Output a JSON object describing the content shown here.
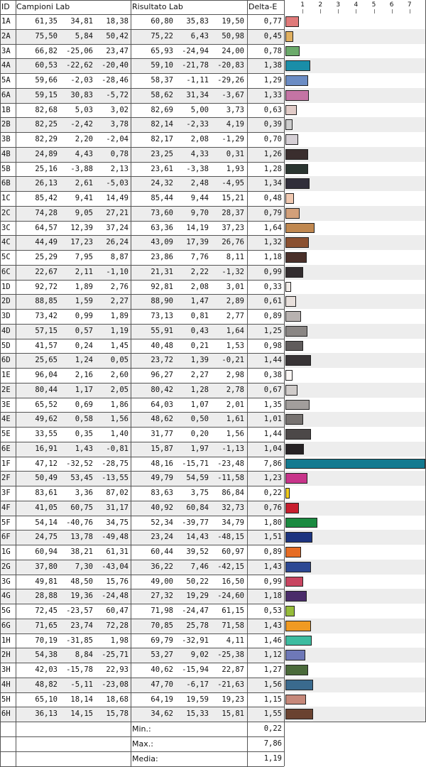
{
  "headers": {
    "id": "ID",
    "campioni": "Campioni Lab",
    "risultato": "Risultato Lab",
    "delta": "Delta-E"
  },
  "scale_ticks": [
    "1",
    "2",
    "3",
    "4",
    "5",
    "6",
    "7"
  ],
  "footer": [
    {
      "label": "Min.:",
      "value": "0,22"
    },
    {
      "label": "Max.:",
      "value": "7,86"
    },
    {
      "label": "Media:",
      "value": "1,19"
    }
  ],
  "chart_data": {
    "type": "bar",
    "xlim": [
      0,
      7.86
    ],
    "rows": [
      {
        "id": "1A",
        "s": [
          "61,35",
          "34,81",
          "18,38"
        ],
        "r": [
          "60,80",
          "35,83",
          "19,50"
        ],
        "de": "0,77",
        "v": 0.77,
        "c": "#e07a7a"
      },
      {
        "id": "2A",
        "s": [
          "75,50",
          "5,84",
          "50,42"
        ],
        "r": [
          "75,22",
          "6,43",
          "50,98"
        ],
        "de": "0,45",
        "v": 0.45,
        "c": "#e0b060"
      },
      {
        "id": "3A",
        "s": [
          "66,82",
          "-25,06",
          "23,47"
        ],
        "r": [
          "65,93",
          "-24,94",
          "24,00"
        ],
        "de": "0,78",
        "v": 0.78,
        "c": "#6aaa6a"
      },
      {
        "id": "4A",
        "s": [
          "60,53",
          "-22,62",
          "-20,40"
        ],
        "r": [
          "59,10",
          "-21,78",
          "-20,83"
        ],
        "de": "1,38",
        "v": 1.38,
        "c": "#1a8ea8"
      },
      {
        "id": "5A",
        "s": [
          "59,66",
          "-2,03",
          "-28,46"
        ],
        "r": [
          "58,37",
          "-1,11",
          "-29,26"
        ],
        "de": "1,29",
        "v": 1.29,
        "c": "#6b8cc4"
      },
      {
        "id": "6A",
        "s": [
          "59,15",
          "30,83",
          "-5,72"
        ],
        "r": [
          "58,62",
          "31,34",
          "-3,67"
        ],
        "de": "1,33",
        "v": 1.33,
        "c": "#c474a4"
      },
      {
        "id": "1B",
        "s": [
          "82,68",
          "5,03",
          "3,02"
        ],
        "r": [
          "82,69",
          "5,00",
          "3,73"
        ],
        "de": "0,63",
        "v": 0.63,
        "c": "#e2ccc8"
      },
      {
        "id": "2B",
        "s": [
          "82,25",
          "-2,42",
          "3,78"
        ],
        "r": [
          "82,14",
          "-2,33",
          "4,19"
        ],
        "de": "0,39",
        "v": 0.39,
        "c": "#cccccc"
      },
      {
        "id": "3B",
        "s": [
          "82,29",
          "2,20",
          "-2,04"
        ],
        "r": [
          "82,17",
          "2,08",
          "-1,29"
        ],
        "de": "0,70",
        "v": 0.7,
        "c": "#d6d0d6"
      },
      {
        "id": "4B",
        "s": [
          "24,89",
          "4,43",
          "0,78"
        ],
        "r": [
          "23,25",
          "4,33",
          "0,31"
        ],
        "de": "1,26",
        "v": 1.26,
        "c": "#3a2e2e"
      },
      {
        "id": "5B",
        "s": [
          "25,16",
          "-3,88",
          "2,13"
        ],
        "r": [
          "23,61",
          "-3,38",
          "1,93"
        ],
        "de": "1,28",
        "v": 1.28,
        "c": "#2a3530"
      },
      {
        "id": "6B",
        "s": [
          "26,13",
          "2,61",
          "-5,03"
        ],
        "r": [
          "24,32",
          "2,48",
          "-4,95"
        ],
        "de": "1,34",
        "v": 1.34,
        "c": "#302e3a"
      },
      {
        "id": "1C",
        "s": [
          "85,42",
          "9,41",
          "14,49"
        ],
        "r": [
          "85,44",
          "9,44",
          "15,21"
        ],
        "de": "0,48",
        "v": 0.48,
        "c": "#f0c8b0"
      },
      {
        "id": "2C",
        "s": [
          "74,28",
          "9,05",
          "27,21"
        ],
        "r": [
          "73,60",
          "9,70",
          "28,37"
        ],
        "de": "0,79",
        "v": 0.79,
        "c": "#d2a07a"
      },
      {
        "id": "3C",
        "s": [
          "64,57",
          "12,39",
          "37,24"
        ],
        "r": [
          "63,36",
          "14,19",
          "37,23"
        ],
        "de": "1,64",
        "v": 1.64,
        "c": "#c08850"
      },
      {
        "id": "4C",
        "s": [
          "44,49",
          "17,23",
          "26,24"
        ],
        "r": [
          "43,09",
          "17,39",
          "26,76"
        ],
        "de": "1,32",
        "v": 1.32,
        "c": "#8a5030"
      },
      {
        "id": "5C",
        "s": [
          "25,29",
          "7,95",
          "8,87"
        ],
        "r": [
          "23,86",
          "7,76",
          "8,11"
        ],
        "de": "1,18",
        "v": 1.18,
        "c": "#4a302a"
      },
      {
        "id": "6C",
        "s": [
          "22,67",
          "2,11",
          "-1,10"
        ],
        "r": [
          "21,31",
          "2,22",
          "-1,32"
        ],
        "de": "0,99",
        "v": 0.99,
        "c": "#322c2e"
      },
      {
        "id": "1D",
        "s": [
          "92,72",
          "1,89",
          "2,76"
        ],
        "r": [
          "92,81",
          "2,08",
          "3,01"
        ],
        "de": "0,33",
        "v": 0.33,
        "c": "#f2ece8"
      },
      {
        "id": "2D",
        "s": [
          "88,85",
          "1,59",
          "2,27"
        ],
        "r": [
          "88,90",
          "1,47",
          "2,89"
        ],
        "de": "0,61",
        "v": 0.61,
        "c": "#e8e0dc"
      },
      {
        "id": "3D",
        "s": [
          "73,42",
          "0,99",
          "1,89"
        ],
        "r": [
          "73,13",
          "0,81",
          "2,77"
        ],
        "de": "0,89",
        "v": 0.89,
        "c": "#b8b2b0"
      },
      {
        "id": "4D",
        "s": [
          "57,15",
          "0,57",
          "1,19"
        ],
        "r": [
          "55,91",
          "0,43",
          "1,64"
        ],
        "de": "1,25",
        "v": 1.25,
        "c": "#8a8684"
      },
      {
        "id": "5D",
        "s": [
          "41,57",
          "0,24",
          "1,45"
        ],
        "r": [
          "40,48",
          "0,21",
          "1,53"
        ],
        "de": "0,98",
        "v": 0.98,
        "c": "#605c5c"
      },
      {
        "id": "6D",
        "s": [
          "25,65",
          "1,24",
          "0,05"
        ],
        "r": [
          "23,72",
          "1,39",
          "-0,21"
        ],
        "de": "1,44",
        "v": 1.44,
        "c": "#383436"
      },
      {
        "id": "1E",
        "s": [
          "96,04",
          "2,16",
          "2,60"
        ],
        "r": [
          "96,27",
          "2,27",
          "2,98"
        ],
        "de": "0,38",
        "v": 0.38,
        "c": "#faf6f4"
      },
      {
        "id": "2E",
        "s": [
          "80,44",
          "1,17",
          "2,05"
        ],
        "r": [
          "80,42",
          "1,28",
          "2,78"
        ],
        "de": "0,67",
        "v": 0.67,
        "c": "#d0ccca"
      },
      {
        "id": "3E",
        "s": [
          "65,52",
          "0,69",
          "1,86"
        ],
        "r": [
          "64,03",
          "1,07",
          "2,01"
        ],
        "de": "1,35",
        "v": 1.35,
        "c": "#a29e9c"
      },
      {
        "id": "4E",
        "s": [
          "49,62",
          "0,58",
          "1,56"
        ],
        "r": [
          "48,62",
          "0,50",
          "1,61"
        ],
        "de": "1,01",
        "v": 1.01,
        "c": "#767270"
      },
      {
        "id": "5E",
        "s": [
          "33,55",
          "0,35",
          "1,40"
        ],
        "r": [
          "31,77",
          "0,20",
          "1,56"
        ],
        "de": "1,44",
        "v": 1.44,
        "c": "#4c4848"
      },
      {
        "id": "6E",
        "s": [
          "16,91",
          "1,43",
          "-0,81"
        ],
        "r": [
          "15,87",
          "1,97",
          "-1,13"
        ],
        "de": "1,04",
        "v": 1.04,
        "c": "#262224"
      },
      {
        "id": "1F",
        "s": [
          "47,12",
          "-32,52",
          "-28,75"
        ],
        "r": [
          "48,16",
          "-15,71",
          "-23,48"
        ],
        "de": "7,86",
        "v": 7.86,
        "c": "#137a90"
      },
      {
        "id": "2F",
        "s": [
          "50,49",
          "53,45",
          "-13,55"
        ],
        "r": [
          "49,79",
          "54,59",
          "-11,58"
        ],
        "de": "1,23",
        "v": 1.23,
        "c": "#c8348a"
      },
      {
        "id": "3F",
        "s": [
          "83,61",
          "3,36",
          "87,02"
        ],
        "r": [
          "83,63",
          "3,75",
          "86,84"
        ],
        "de": "0,22",
        "v": 0.22,
        "c": "#f2cc1a"
      },
      {
        "id": "4F",
        "s": [
          "41,05",
          "60,75",
          "31,17"
        ],
        "r": [
          "40,92",
          "60,84",
          "32,73"
        ],
        "de": "0,76",
        "v": 0.76,
        "c": "#c81e2e"
      },
      {
        "id": "5F",
        "s": [
          "54,14",
          "-40,76",
          "34,75"
        ],
        "r": [
          "52,34",
          "-39,77",
          "34,79"
        ],
        "de": "1,80",
        "v": 1.8,
        "c": "#1a8a40"
      },
      {
        "id": "6F",
        "s": [
          "24,75",
          "13,78",
          "-49,48"
        ],
        "r": [
          "23,24",
          "14,43",
          "-48,15"
        ],
        "de": "1,51",
        "v": 1.51,
        "c": "#1c3480"
      },
      {
        "id": "1G",
        "s": [
          "60,94",
          "38,21",
          "61,31"
        ],
        "r": [
          "60,44",
          "39,52",
          "60,97"
        ],
        "de": "0,89",
        "v": 0.89,
        "c": "#e66c24"
      },
      {
        "id": "2G",
        "s": [
          "37,80",
          "7,30",
          "-43,04"
        ],
        "r": [
          "36,22",
          "7,46",
          "-42,15"
        ],
        "de": "1,43",
        "v": 1.43,
        "c": "#2c4894"
      },
      {
        "id": "3G",
        "s": [
          "49,81",
          "48,50",
          "15,76"
        ],
        "r": [
          "49,00",
          "50,22",
          "16,50"
        ],
        "de": "0,99",
        "v": 0.99,
        "c": "#c84460"
      },
      {
        "id": "4G",
        "s": [
          "28,88",
          "19,36",
          "-24,48"
        ],
        "r": [
          "27,32",
          "19,29",
          "-24,60"
        ],
        "de": "1,18",
        "v": 1.18,
        "c": "#4a2c6a"
      },
      {
        "id": "5G",
        "s": [
          "72,45",
          "-23,57",
          "60,47"
        ],
        "r": [
          "71,98",
          "-24,47",
          "61,15"
        ],
        "de": "0,53",
        "v": 0.53,
        "c": "#96bc3a"
      },
      {
        "id": "6G",
        "s": [
          "71,65",
          "23,74",
          "72,28"
        ],
        "r": [
          "70,85",
          "25,78",
          "71,58"
        ],
        "de": "1,43",
        "v": 1.43,
        "c": "#f09a22"
      },
      {
        "id": "1H",
        "s": [
          "70,19",
          "-31,85",
          "1,98"
        ],
        "r": [
          "69,79",
          "-32,91",
          "4,11"
        ],
        "de": "1,46",
        "v": 1.46,
        "c": "#3cbca0"
      },
      {
        "id": "2H",
        "s": [
          "54,38",
          "8,84",
          "-25,71"
        ],
        "r": [
          "53,27",
          "9,02",
          "-25,38"
        ],
        "de": "1,12",
        "v": 1.12,
        "c": "#6e78b8"
      },
      {
        "id": "3H",
        "s": [
          "42,03",
          "-15,78",
          "22,93"
        ],
        "r": [
          "40,62",
          "-15,94",
          "22,87"
        ],
        "de": "1,27",
        "v": 1.27,
        "c": "#4a6a3a"
      },
      {
        "id": "4H",
        "s": [
          "48,82",
          "-5,11",
          "-23,08"
        ],
        "r": [
          "47,70",
          "-6,17",
          "-21,63"
        ],
        "de": "1,56",
        "v": 1.56,
        "c": "#3a6a8e"
      },
      {
        "id": "5H",
        "s": [
          "65,10",
          "18,14",
          "18,68"
        ],
        "r": [
          "64,19",
          "19,59",
          "19,23"
        ],
        "de": "1,15",
        "v": 1.15,
        "c": "#c6887a"
      },
      {
        "id": "6H",
        "s": [
          "36,13",
          "14,15",
          "15,78"
        ],
        "r": [
          "34,62",
          "15,33",
          "15,81"
        ],
        "de": "1,55",
        "v": 1.55,
        "c": "#6a4230"
      }
    ]
  }
}
